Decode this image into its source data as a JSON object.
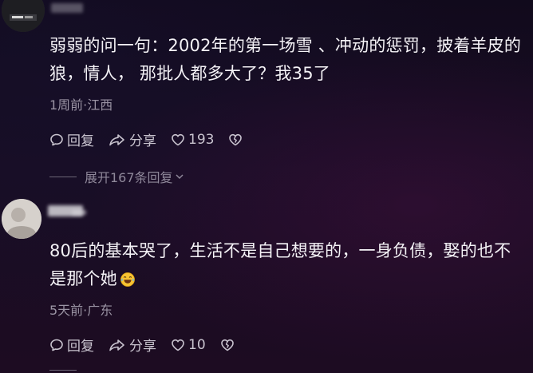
{
  "comments": [
    {
      "text_line1": "弱弱的问一句：2002年的第一场雪 、冲动的惩罚，披着羊皮的",
      "text_line2": "狼，情人，  那批人都多大了？我35了",
      "meta": "1周前·江西",
      "reply_label": "回复",
      "share_label": "分享",
      "like_count": "193",
      "expand_label": "展开167条回复"
    },
    {
      "text_line1": "80后的基本哭了，生活不是自己想要的，一身负债，娶的也不",
      "text_line2": "是那个她",
      "meta": "5天前·广东",
      "reply_label": "回复",
      "share_label": "分享",
      "like_count": "10"
    }
  ],
  "icons": {
    "reply": "speech-bubble-icon",
    "share": "share-arrow-icon",
    "like": "heart-icon",
    "dislike": "broken-heart-icon",
    "emoji": "laughing-crying-emoji-icon"
  },
  "colors": {
    "background": "#170c20",
    "text": "#f4f2f6",
    "meta": "#9a93a3",
    "action": "#c9c4cf"
  }
}
